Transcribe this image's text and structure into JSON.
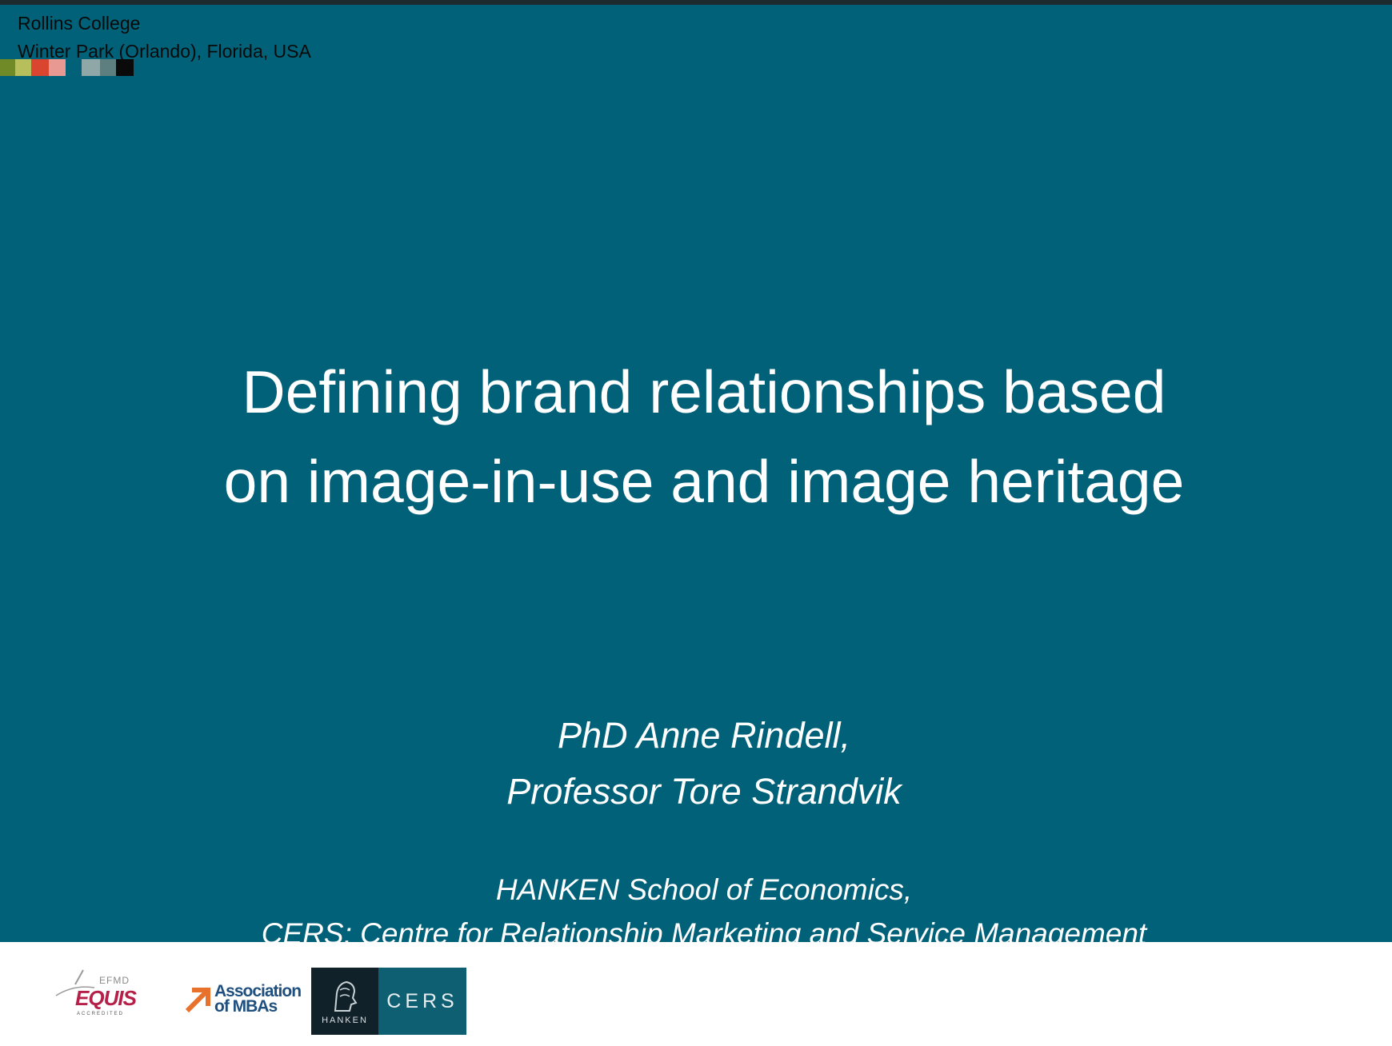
{
  "header": {
    "institution": "Rollins College",
    "location": "Winter Park (Orlando), Florida, USA"
  },
  "swatches": [
    "#6f8a26",
    "#b7bf5d",
    "#d9452f",
    "#e89a92",
    "#006179",
    "#8fa7a6",
    "#5e7f7f",
    "#0a0a0a"
  ],
  "title": {
    "line1": "Defining brand relationships based",
    "line2": "on image-in-use and image heritage"
  },
  "authors": {
    "line1": "PhD Anne Rindell,",
    "line2": "Professor Tore Strandvik"
  },
  "affiliation": {
    "line1": "HANKEN School of Economics,",
    "line2": "CERS: Centre for Relationship Marketing and Service Management"
  },
  "footer_logos": {
    "equis": {
      "top_text": "EFMD",
      "main_text": "EQUIS",
      "sub_text": "ACCREDITED"
    },
    "amba": {
      "line1": "Association",
      "line2": "of MBAs"
    },
    "hanken": {
      "text": "HANKEN"
    },
    "cers": {
      "text": "CERS"
    }
  },
  "colors": {
    "slide_background": "#006179",
    "title_text": "#ffffff",
    "footer_background": "#ffffff"
  }
}
